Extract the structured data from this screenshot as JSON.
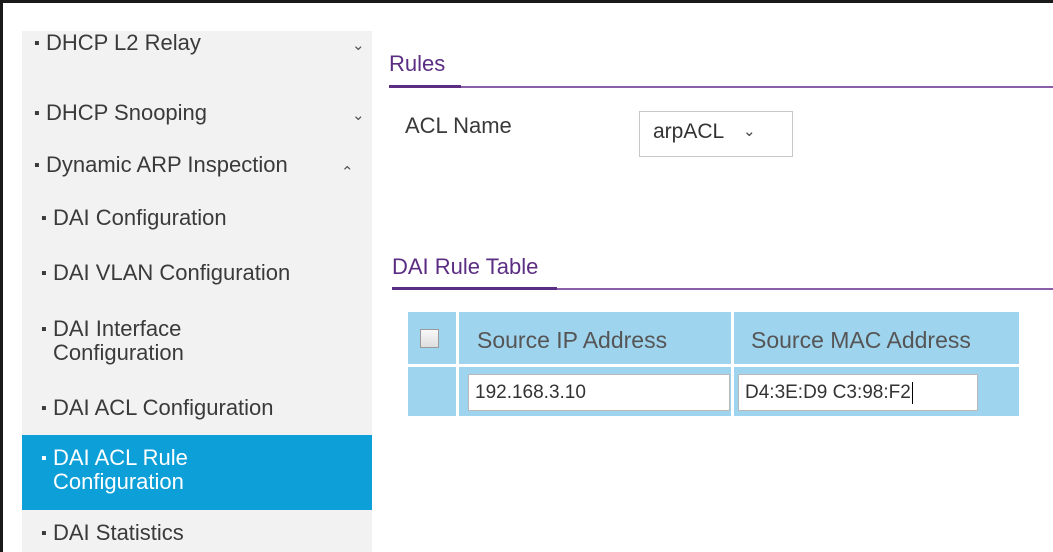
{
  "sidebar": {
    "items": [
      {
        "label": "DHCP L2 Relay",
        "chevron": "chevron-down-icon",
        "glyph": "⌄"
      },
      {
        "label": "DHCP Snooping",
        "chevron": "chevron-down-icon",
        "glyph": "⌄"
      },
      {
        "label": "Dynamic ARP Inspection",
        "chevron": "chevron-up-icon",
        "glyph": "⌃"
      },
      {
        "label": "DAI Configuration"
      },
      {
        "label": "DAI VLAN Configuration"
      },
      {
        "label_line1": "DAI Interface",
        "label_line2": "Configuration"
      },
      {
        "label": "DAI ACL Configuration"
      },
      {
        "label_line1": "DAI ACL Rule",
        "label_line2": "Configuration",
        "active": true
      },
      {
        "label": "DAI Statistics"
      }
    ],
    "bullet": "▪"
  },
  "rules_section": {
    "title": "Rules",
    "acl_name_label": "ACL Name",
    "acl_name_value": "arpACL",
    "chevron_glyph": "⌄"
  },
  "dai_rule_table": {
    "title": "DAI Rule Table",
    "columns": [
      "Source IP Address",
      "Source MAC Address"
    ],
    "row": {
      "source_ip": "192.168.3.10",
      "source_mac": "D4:3E:D9 C3:98:F2"
    }
  },
  "colors": {
    "accent_purple": "#5b2d83",
    "active_blue": "#0d9fd8",
    "table_blue": "#9fd4ef",
    "sidebar_bg": "#f2f2f2"
  }
}
